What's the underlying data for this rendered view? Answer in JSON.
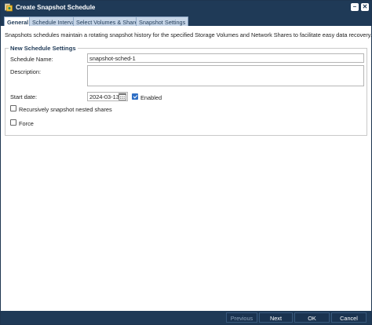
{
  "window": {
    "title": "Create Snapshot Schedule",
    "min_label": "–",
    "close_label": "✕"
  },
  "tabs": [
    {
      "label": "General",
      "active": true
    },
    {
      "label": "Schedule Interval",
      "active": false
    },
    {
      "label": "Select Volumes & Shares",
      "active": false
    },
    {
      "label": "Snapshot Settings",
      "active": false
    }
  ],
  "description": "Snapshots schedules maintain a rotating snapshot history for the specified Storage Volumes and Network Shares to facilitate easy data recovery.",
  "settings": {
    "legend": "New Schedule Settings",
    "schedule_name_label": "Schedule Name:",
    "schedule_name_value": "snapshot-sched-1",
    "description_label": "Description:",
    "description_value": "",
    "start_date_label": "Start date:",
    "start_date_value": "2024-03-13",
    "enabled_label": "Enabled",
    "enabled_checked": true,
    "recursive_label": "Recursively snapshot nested shares",
    "recursive_checked": false,
    "force_label": "Force",
    "force_checked": false
  },
  "footer": {
    "previous_label": "Previous",
    "next_label": "Next",
    "ok_label": "OK",
    "cancel_label": "Cancel"
  },
  "colors": {
    "header": "#1f3a57",
    "accent": "#2f6fc5"
  },
  "icons": {
    "app": "snapshot-schedule-icon",
    "calendar": "calendar-icon"
  }
}
